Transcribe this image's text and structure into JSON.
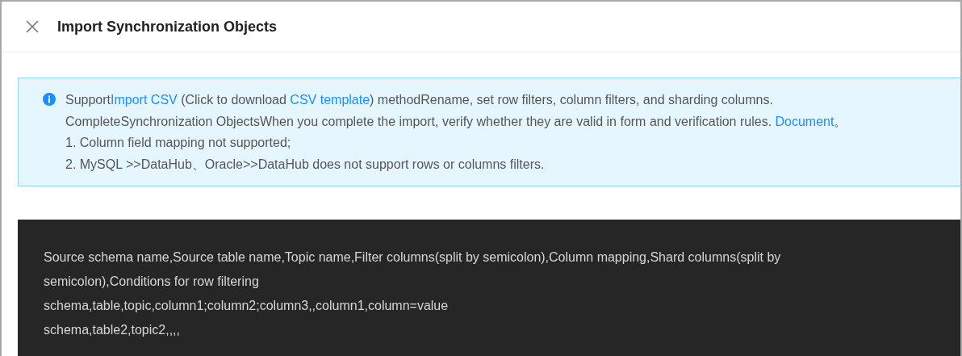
{
  "dialog": {
    "title": "Import Synchronization Objects"
  },
  "notice": {
    "lines": [
      {
        "segments": [
          {
            "kind": "text",
            "text": "Support"
          },
          {
            "kind": "link",
            "text": "Import CSV"
          },
          {
            "kind": "text",
            "text": " (Click to download "
          },
          {
            "kind": "link",
            "text": "CSV template"
          },
          {
            "kind": "text",
            "text": ") methodRename, set row filters, column filters, and sharding columns."
          }
        ]
      },
      {
        "segments": [
          {
            "kind": "text",
            "text": "CompleteSynchronization ObjectsWhen you complete the import, verify whether they are valid in form and verification rules. "
          },
          {
            "kind": "link",
            "text": "Document"
          },
          {
            "kind": "text",
            "text": "。"
          }
        ]
      },
      {
        "segments": [
          {
            "kind": "text",
            "text": "1. Column field mapping not supported;"
          }
        ]
      },
      {
        "segments": [
          {
            "kind": "text",
            "text": "2. MySQL >>DataHub、Oracle>>DataHub does not support rows or columns filters."
          }
        ]
      }
    ]
  },
  "csv_sample": {
    "lines": [
      "Source schema name,Source table name,Topic name,Filter columns(split by semicolon),Column mapping,Shard columns(split by semicolon),Conditions for row filtering",
      "schema,table,topic,column1;column2;column3,,column1,column=value",
      "schema,table2,topic2,,,,"
    ]
  }
}
